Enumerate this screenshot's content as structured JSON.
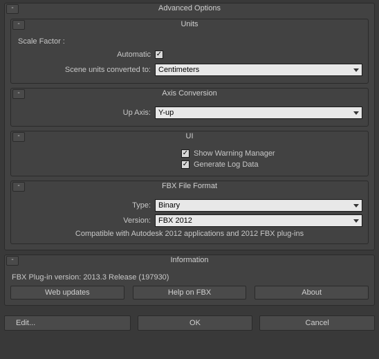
{
  "advanced": {
    "title": "Advanced Options",
    "units": {
      "title": "Units",
      "scale_factor_label": "Scale Factor :",
      "automatic_label": "Automatic",
      "converted_label": "Scene units converted to:",
      "converted_value": "Centimeters"
    },
    "axis": {
      "title": "Axis Conversion",
      "up_axis_label": "Up Axis:",
      "up_axis_value": "Y-up"
    },
    "ui": {
      "title": "UI",
      "warning_label": "Show Warning Manager",
      "log_label": "Generate Log Data"
    },
    "fbx": {
      "title": "FBX File Format",
      "type_label": "Type:",
      "type_value": "Binary",
      "version_label": "Version:",
      "version_value": "FBX 2012",
      "note": "Compatible with Autodesk 2012 applications and 2012 FBX plug-ins"
    }
  },
  "info": {
    "title": "Information",
    "plugin_version": "FBX Plug-in version: 2013.3 Release (197930)",
    "web_updates": "Web updates",
    "help": "Help on FBX",
    "about": "About"
  },
  "footer": {
    "edit": "Edit...",
    "ok": "OK",
    "cancel": "Cancel"
  }
}
